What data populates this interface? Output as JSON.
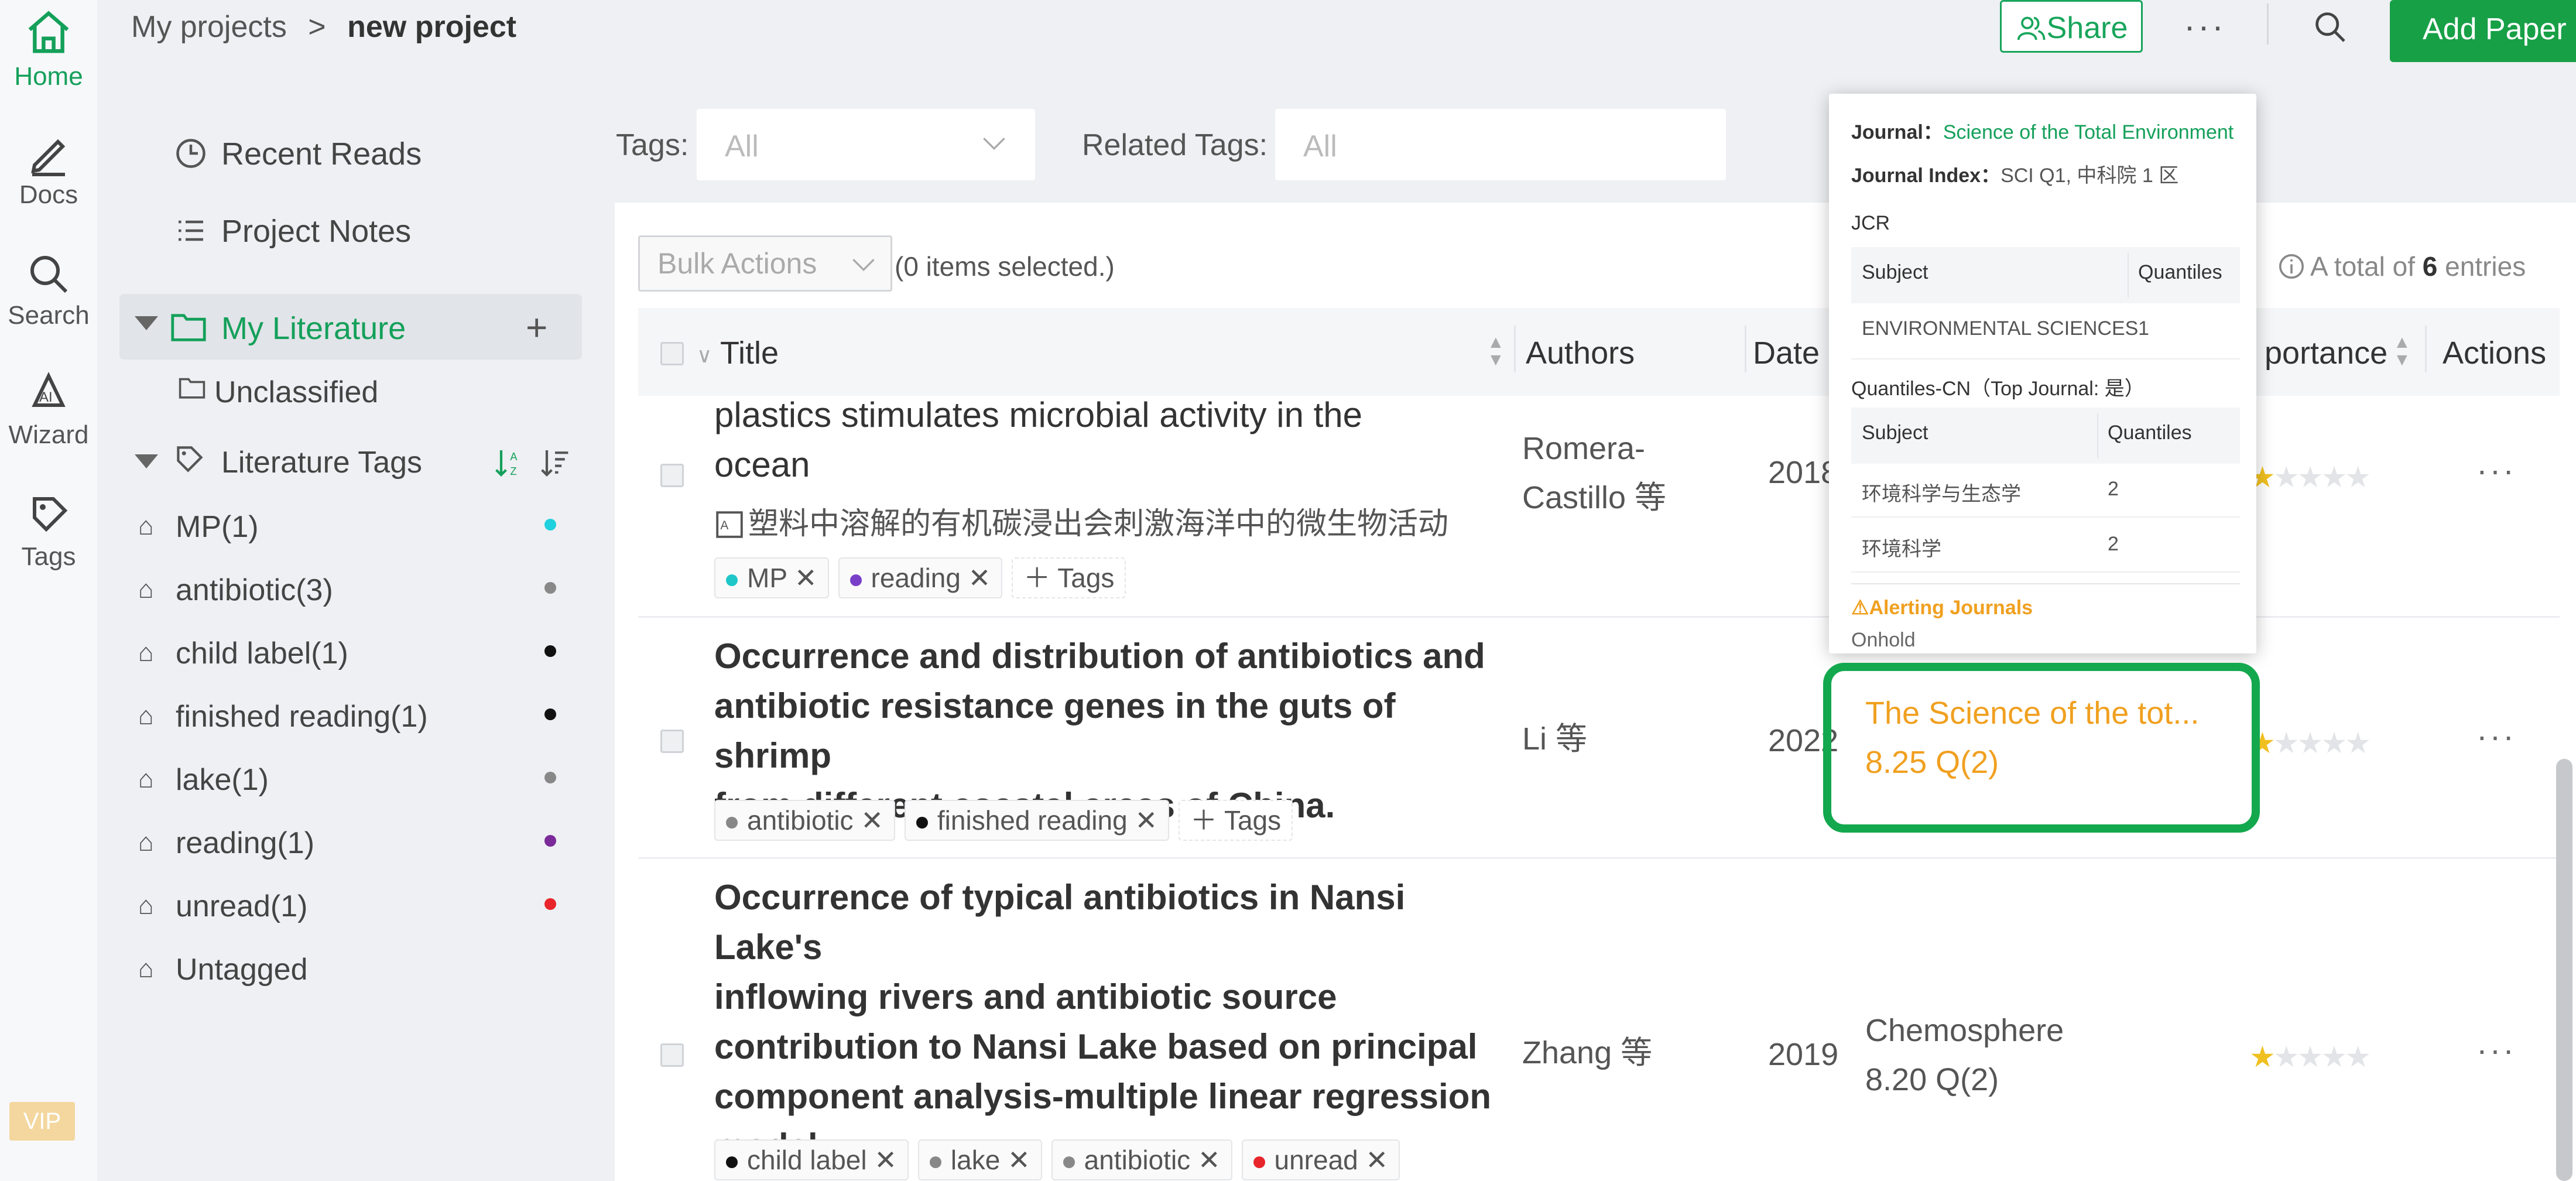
{
  "rail": {
    "items": [
      {
        "label": "Home",
        "icon": "home-icon",
        "active": true
      },
      {
        "label": "Docs",
        "icon": "pen-icon"
      },
      {
        "label": "Search",
        "icon": "search-icon"
      },
      {
        "label": "Wizard",
        "icon": "ai-icon"
      },
      {
        "label": "Tags",
        "icon": "tag-icon"
      }
    ],
    "vip": "VIP"
  },
  "header": {
    "breadcrumb_root": "My projects",
    "breadcrumb_sep": ">",
    "breadcrumb_current": "new project",
    "share": "Share",
    "more": "···",
    "add_paper": "Add Paper"
  },
  "sidebar": {
    "recent_reads": "Recent Reads",
    "project_notes": "Project Notes",
    "my_literature": "My Literature",
    "unclassified": "Unclassified",
    "literature_tags": "Literature Tags",
    "tags": [
      {
        "label": "MP(1)",
        "color": "#1fd0dd"
      },
      {
        "label": "antibiotic(3)",
        "color": "#888888"
      },
      {
        "label": "child label(1)",
        "color": "#111111"
      },
      {
        "label": "finished reading(1)",
        "color": "#111111"
      },
      {
        "label": "lake(1)",
        "color": "#888888"
      },
      {
        "label": "reading(1)",
        "color": "#7b2a9a"
      },
      {
        "label": "unread(1)",
        "color": "#e8252a"
      }
    ],
    "untagged": "Untagged"
  },
  "filters": {
    "tags_label": "Tags:",
    "tags_value": "All",
    "related_label": "Related Tags:",
    "related_placeholder": "All"
  },
  "table": {
    "bulk_actions": "Bulk Actions",
    "selected": "(0 items selected.)",
    "total_prefix": "A total of",
    "total_count": "6",
    "total_suffix": "entries",
    "columns": {
      "title": "Title",
      "authors": "Authors",
      "date": "Date",
      "importance": "portance",
      "actions": "Actions"
    },
    "rows": [
      {
        "title_lines": [
          "plastics stimulates microbial activity in the",
          "ocean"
        ],
        "title_cn": "塑料中溶解的有机碳浸出会刺激海洋中的微生物活动",
        "tags": [
          {
            "label": "MP",
            "color": "#1fc7c9"
          },
          {
            "label": "reading",
            "color": "#7a3fc8"
          }
        ],
        "add_tag": "Tags",
        "author_lines": [
          "Romera-",
          "Castillo 等"
        ],
        "year": "2018",
        "rating": 1,
        "actions": "···"
      },
      {
        "title_lines": [
          "Occurrence and distribution of antibiotics and",
          "antibiotic resistance genes in the guts of shrimp",
          "from different coastal areas of China."
        ],
        "tags": [
          {
            "label": "antibiotic",
            "color": "#888888"
          },
          {
            "label": "finished reading",
            "color": "#111111"
          }
        ],
        "add_tag": "Tags",
        "author_lines": [
          "Li 等"
        ],
        "year": "2022",
        "journal_lines": [
          "The Science of the tot...",
          "8.25 Q(2)"
        ],
        "rating": 1,
        "actions": "···"
      },
      {
        "title_lines": [
          "Occurrence of typical antibiotics in Nansi Lake's",
          "inflowing rivers and antibiotic source",
          "contribution to Nansi Lake based on principal",
          "component analysis-multiple linear regression",
          "model"
        ],
        "tags": [
          {
            "label": "child label",
            "color": "#111111"
          },
          {
            "label": "lake",
            "color": "#888888"
          },
          {
            "label": "antibiotic",
            "color": "#888888"
          },
          {
            "label": "unread",
            "color": "#e8252a"
          }
        ],
        "author_lines": [
          "Zhang 等"
        ],
        "year": "2019",
        "journal_lines": [
          "Chemosphere",
          "8.20 Q(2)"
        ],
        "rating": 1,
        "actions": "···"
      }
    ]
  },
  "popup": {
    "journal_label": "Journal：",
    "journal_value": "Science of the Total Environment",
    "index_label": "Journal Index：",
    "index_value": "SCI Q1, 中科院 1 区",
    "jcr": "JCR",
    "jcr_head": [
      "Subject",
      "Quantiles"
    ],
    "jcr_rows": [
      [
        "ENVIRONMENTAL SCIENCES",
        "1"
      ]
    ],
    "cn_title": "Quantiles-CN（Top Journal: 是）",
    "cn_head": [
      "Subject",
      "Quantiles"
    ],
    "cn_rows": [
      [
        "环境科学与生态学",
        "2"
      ],
      [
        "环境科学",
        "2"
      ]
    ],
    "alert": "⚠Alerting Journals",
    "onhold": "Onhold"
  },
  "colors": {
    "accent": "#14a05a",
    "journal_highlight": "#f0a020"
  }
}
